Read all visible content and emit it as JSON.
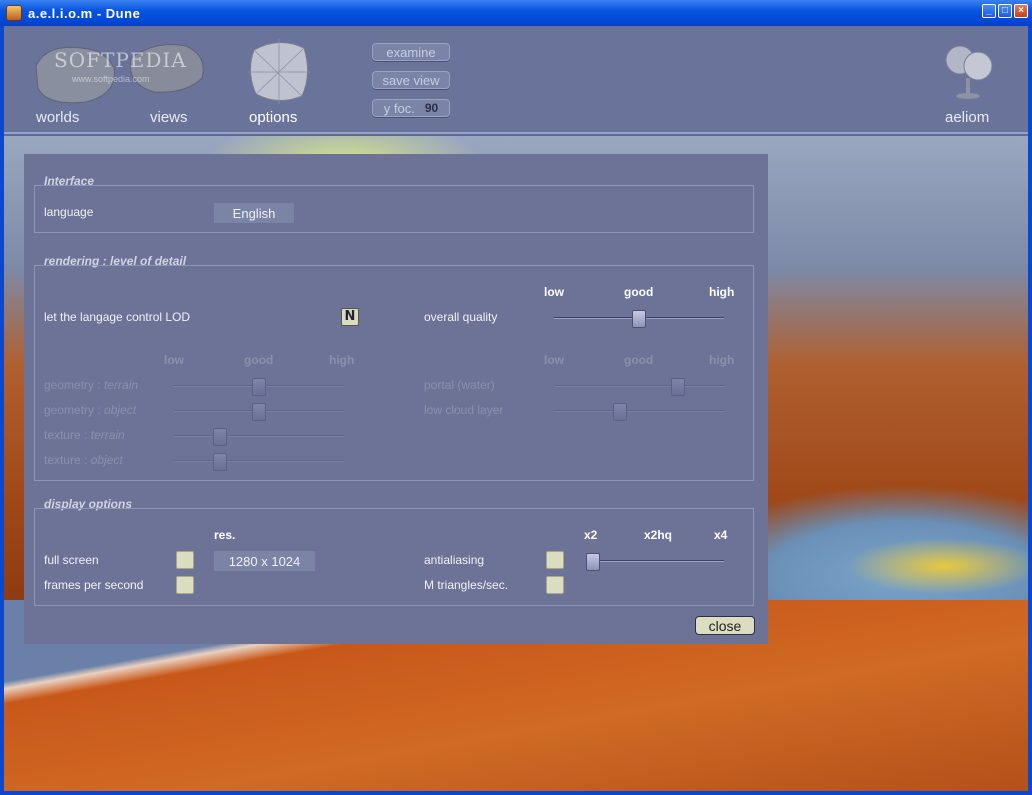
{
  "window": {
    "title": "a.e.l.i.o.m  -  Dune",
    "minimize": "_",
    "maximize": "□",
    "close": "×"
  },
  "nav": {
    "worlds": "worlds",
    "views": "views",
    "options": "options",
    "aeliom": "aeliom",
    "watermark": "SOFTPEDIA",
    "watermark_url": "www.softpedia.com"
  },
  "toolbar": {
    "examine": "examine",
    "save_view": "save view",
    "y_foc_label": "y foc.",
    "y_foc_value": "90"
  },
  "interface": {
    "title": "Interface",
    "language_label": "language",
    "language_value": "English"
  },
  "rendering": {
    "title": "rendering : level of detail",
    "let_language_control": "let the langage control LOD",
    "lod_toggle": "N",
    "overall_quality": "overall quality",
    "low": "low",
    "good": "good",
    "high": "high",
    "geometry": "geometry :",
    "terrain": "terrain",
    "object": "object",
    "texture": "texture :",
    "portal_water": "portal (water)",
    "low_cloud_layer": "low cloud layer",
    "levels": {
      "overall_quality": 0.5,
      "geometry_terrain": 0.5,
      "geometry_object": 0.5,
      "texture_terrain": 0.25,
      "texture_object": 0.25,
      "portal_water": 0.75,
      "low_cloud_layer": 0.38
    }
  },
  "display": {
    "title": "display options",
    "res_label": "res.",
    "res_value": "1280 x 1024",
    "full_screen": "full screen",
    "frames_per_second": "frames per second",
    "antialiasing": "antialiasing",
    "m_triangles": "M triangles/sec.",
    "x2": "x2",
    "x2hq": "x2hq",
    "x4": "x4",
    "antialiasing_level": 0
  },
  "close_label": "close",
  "colors": {
    "panel": "#6c7396",
    "accent_checkbox": "#dcdcc0",
    "titlebar": "#0a55e0"
  }
}
